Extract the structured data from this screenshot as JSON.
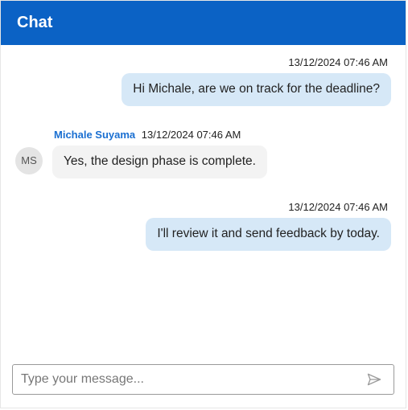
{
  "header": {
    "title": "Chat"
  },
  "messages": [
    {
      "side": "right",
      "timestamp": "13/12/2024 07:46 AM",
      "text": "Hi Michale, are we on track for the deadline?"
    },
    {
      "side": "left",
      "author": "Michale Suyama",
      "initials": "MS",
      "timestamp": "13/12/2024 07:46 AM",
      "text": "Yes, the design phase is complete."
    },
    {
      "side": "right",
      "timestamp": "13/12/2024 07:46 AM",
      "text": "I'll review it and send feedback by today."
    }
  ],
  "composer": {
    "placeholder": "Type your message...",
    "value": ""
  }
}
